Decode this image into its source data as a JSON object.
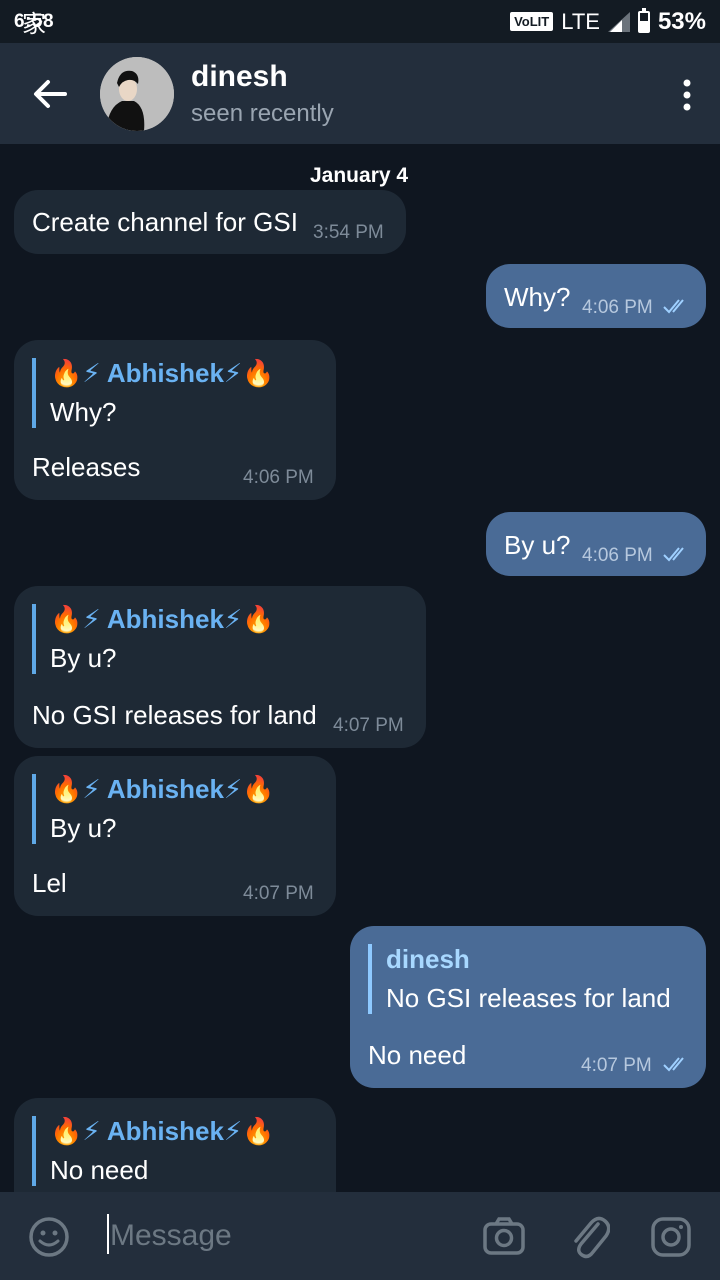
{
  "statusbar": {
    "time": "6:58",
    "carrier_glyph": "家",
    "volte": "VoLIT",
    "network": "LTE",
    "battery_pct": "53%",
    "battery_level": 0.53
  },
  "header": {
    "name": "dinesh",
    "status": "seen recently"
  },
  "date_label": "January 4",
  "messages": [
    {
      "dir": "in",
      "text": "Create channel for GSI",
      "time": "3:54 PM"
    },
    {
      "dir": "out",
      "text": "Why?",
      "time": "4:06 PM"
    },
    {
      "dir": "in",
      "reply_name": "🔥⚡ Abhishek⚡🔥",
      "reply_text": "Why?",
      "text": "Releases",
      "time": "4:06 PM"
    },
    {
      "dir": "out",
      "text": "By u?",
      "time": "4:06 PM"
    },
    {
      "dir": "in",
      "reply_name": "🔥⚡ Abhishek⚡🔥",
      "reply_text": "By u?",
      "text": "No GSI releases for land",
      "time": "4:07 PM"
    },
    {
      "dir": "in",
      "reply_name": "🔥⚡ Abhishek⚡🔥",
      "reply_text": "By u?",
      "text": "Lel",
      "time": "4:07 PM"
    },
    {
      "dir": "out",
      "reply_name": "dinesh",
      "reply_text": "No GSI releases for land",
      "text": "No need",
      "time": "4:07 PM"
    },
    {
      "dir": "in",
      "reply_name": "🔥⚡ Abhishek⚡🔥",
      "reply_text": "No need"
    }
  ],
  "input": {
    "placeholder": "Message"
  },
  "icons": {
    "emoji": "emoji-icon",
    "camera": "camera-icon",
    "attach": "paperclip-icon",
    "instagram": "instagram-icon"
  },
  "colors": {
    "header_bg": "#232e3c",
    "chat_bg": "#0f1620",
    "incoming": "#1e2935",
    "outgoing": "#4a6b96",
    "link": "#6ab2f2"
  }
}
